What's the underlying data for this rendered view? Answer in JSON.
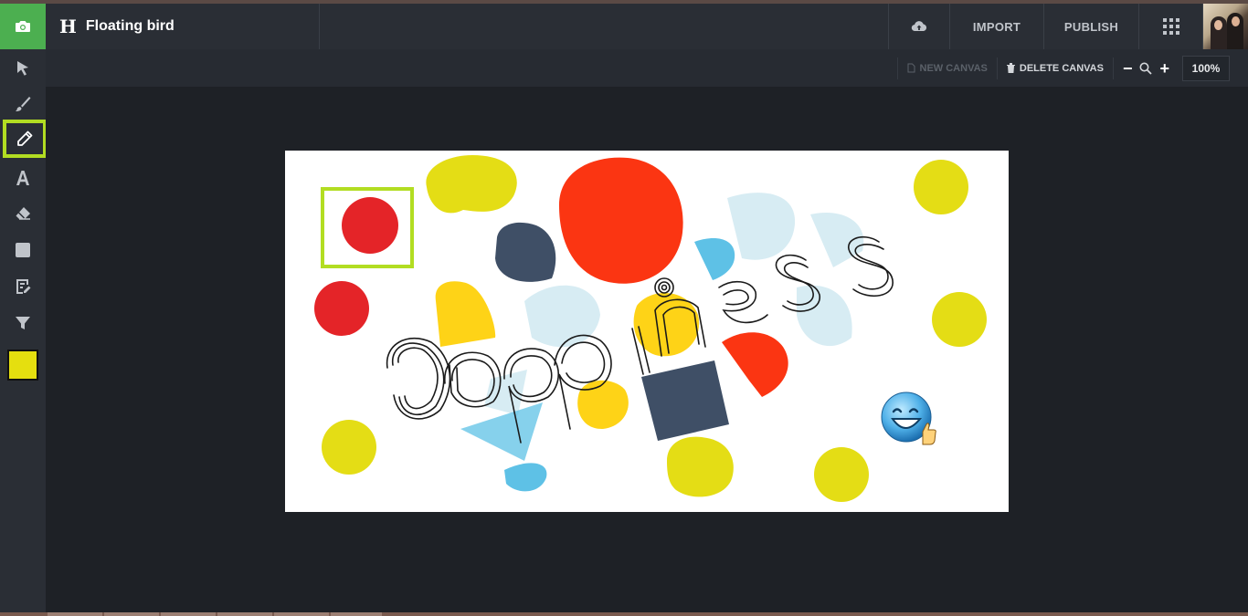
{
  "app": {
    "title": "Floating bird",
    "logo_letter": "H"
  },
  "topbar": {
    "import_label": "IMPORT",
    "publish_label": "PUBLISH",
    "icons": [
      "camera-icon",
      "cloud-upload-icon",
      "grid-icon"
    ]
  },
  "toolbar": {
    "new_canvas_label": "NEW CANVAS",
    "delete_canvas_label": "DELETE CANVAS",
    "zoom_out": "−",
    "zoom_in": "+",
    "zoom_level": "100%"
  },
  "sidebar": {
    "tools": [
      "select-tool",
      "brush-tool",
      "pencil-tool",
      "text-tool",
      "eraser-tool",
      "shape-tool",
      "image-tool",
      "filter-tool"
    ],
    "active_tool": "pencil-tool",
    "current_color": "#e5df0f"
  },
  "canvas": {
    "word": "Happiness",
    "colors": {
      "yellow": "#e4dd15",
      "red": "#e42428",
      "orange_red": "#fb3512",
      "navy": "#3f4f66",
      "light_blue": "#5ec1e6",
      "pale_blue": "#d7ecf3",
      "gold": "#fed317"
    }
  },
  "colors": {
    "accent_green": "#4caf50",
    "selection_lime": "#b2dd22",
    "topbar_bg": "#2a2e35",
    "workspace_bg": "#1e2126"
  }
}
